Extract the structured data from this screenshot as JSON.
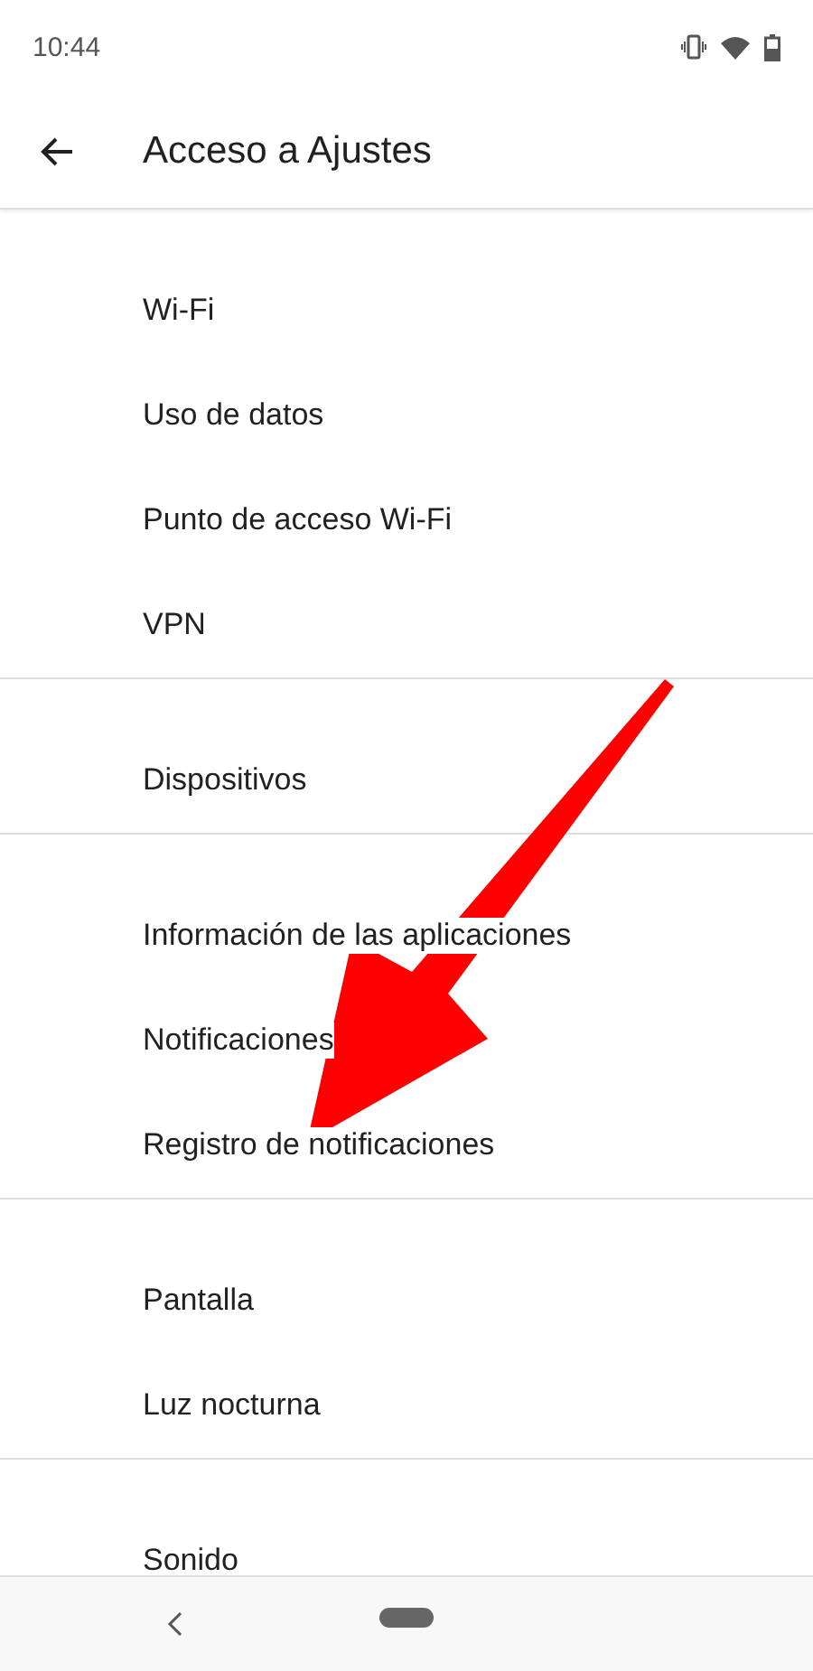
{
  "status_bar": {
    "time": "10:44"
  },
  "header": {
    "title": "Acceso a Ajustes"
  },
  "sections": [
    {
      "items": [
        "Wi-Fi",
        "Uso de datos",
        "Punto de acceso Wi-Fi",
        "VPN"
      ]
    },
    {
      "items": [
        "Dispositivos"
      ]
    },
    {
      "items": [
        "Información de las aplicaciones",
        "Notificaciones",
        "Registro de notificaciones"
      ]
    },
    {
      "items": [
        "Pantalla",
        "Luz nocturna"
      ]
    },
    {
      "items": [
        "Sonido"
      ]
    }
  ]
}
